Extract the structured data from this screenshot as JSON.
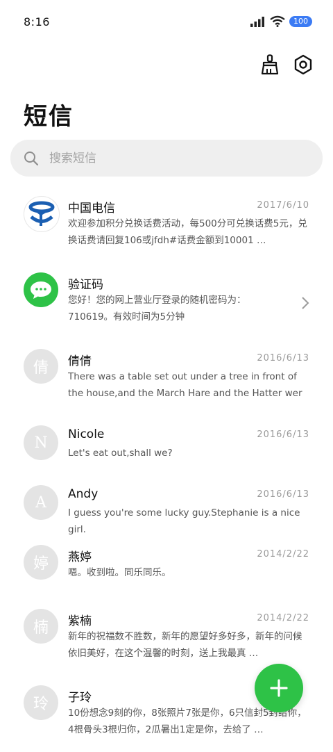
{
  "status": {
    "time": "8:16",
    "battery": "100",
    "icons": [
      "signal-icon",
      "wifi-icon",
      "battery-icon"
    ]
  },
  "actions": {
    "clean_icon": "broom-icon",
    "settings_icon": "settings-icon"
  },
  "title": "短信",
  "search": {
    "placeholder": "搜索短信"
  },
  "messages": [
    {
      "name": "中国电信",
      "date": "2017/6/10",
      "preview": "欢迎参加积分兑换话费活动，每500分可兑换话费5元，兑换话费请回复106或jfdh#话费金额到10001 …",
      "avatar": "telecom-logo"
    },
    {
      "name": "验证码",
      "date": "",
      "preview": "您好！您的网上营业厅登录的随机密码为：710619。有效时间为5分钟",
      "avatar": "chat-bubble-icon"
    },
    {
      "name": "倩倩",
      "date": "2016/6/13",
      "preview": "There was a table set out under a tree in front of the house,and the March Hare and the Hatter wer …",
      "avatar": "倩"
    },
    {
      "name": "Nicole",
      "date": "2016/6/13",
      "preview": "Let's eat out,shall we?",
      "avatar": "N"
    },
    {
      "name": "Andy",
      "date": "2016/6/13",
      "preview": "I guess you're some lucky guy.Stephanie is a nice girl.",
      "avatar": "A"
    },
    {
      "name": "燕婷",
      "date": "2014/2/22",
      "preview": "嗯。收到啦。同乐同乐。",
      "avatar": "婷"
    },
    {
      "name": "紫楠",
      "date": "2014/2/22",
      "preview": "新年的祝福数不胜数，新年的愿望好多好多，新年的问候依旧美好，在这个温馨的时刻，送上我最真 …",
      "avatar": "楠"
    },
    {
      "name": "子玲",
      "date": "",
      "preview": "10份想念9刻的你，8张照片7张是你，6只信封5封给你，4根骨头3根归你，2瓜暑出1定是你，去给了 …",
      "avatar": "玲"
    }
  ],
  "colors": {
    "accent": "#2ec247",
    "battery": "#3b7bf4",
    "telecom": "#1b5fb2"
  },
  "fab_icon": "plus-icon"
}
